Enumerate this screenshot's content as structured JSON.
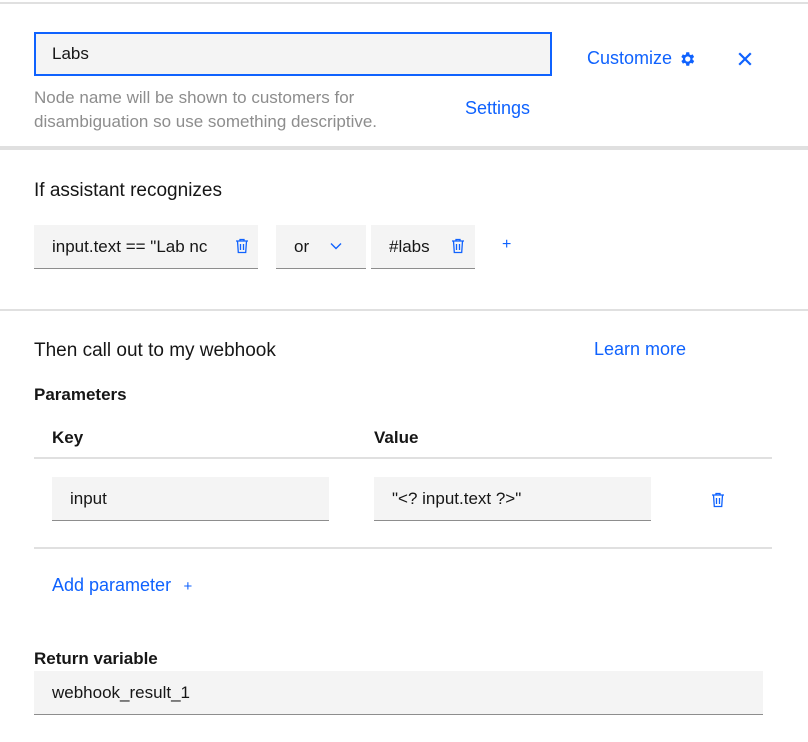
{
  "header": {
    "node_name_value": "Labs",
    "node_name_hint": "Node name will be shown to customers for disambiguation so use something descriptive.",
    "settings_label": "Settings",
    "customize_label": "Customize"
  },
  "conditions": {
    "title": "If assistant recognizes",
    "first_condition": "input.text == \"Lab nc",
    "operator": "or",
    "second_condition": "#labs",
    "add_symbol": "+"
  },
  "webhook": {
    "title": "Then call out to my webhook",
    "learn_more_label": "Learn more",
    "parameters_label": "Parameters",
    "key_header": "Key",
    "value_header": "Value",
    "rows": [
      {
        "key": "input",
        "value": "\"<? input.text ?>\""
      }
    ],
    "add_parameter_label": "Add parameter",
    "add_parameter_symbol": "+",
    "return_variable_label": "Return variable",
    "return_variable_value": "webhook_result_1"
  },
  "colors": {
    "accent": "#0f62fe",
    "field_bg": "#f4f4f4",
    "divider": "#e0e0e0",
    "hint_text": "#8d8d8d"
  }
}
